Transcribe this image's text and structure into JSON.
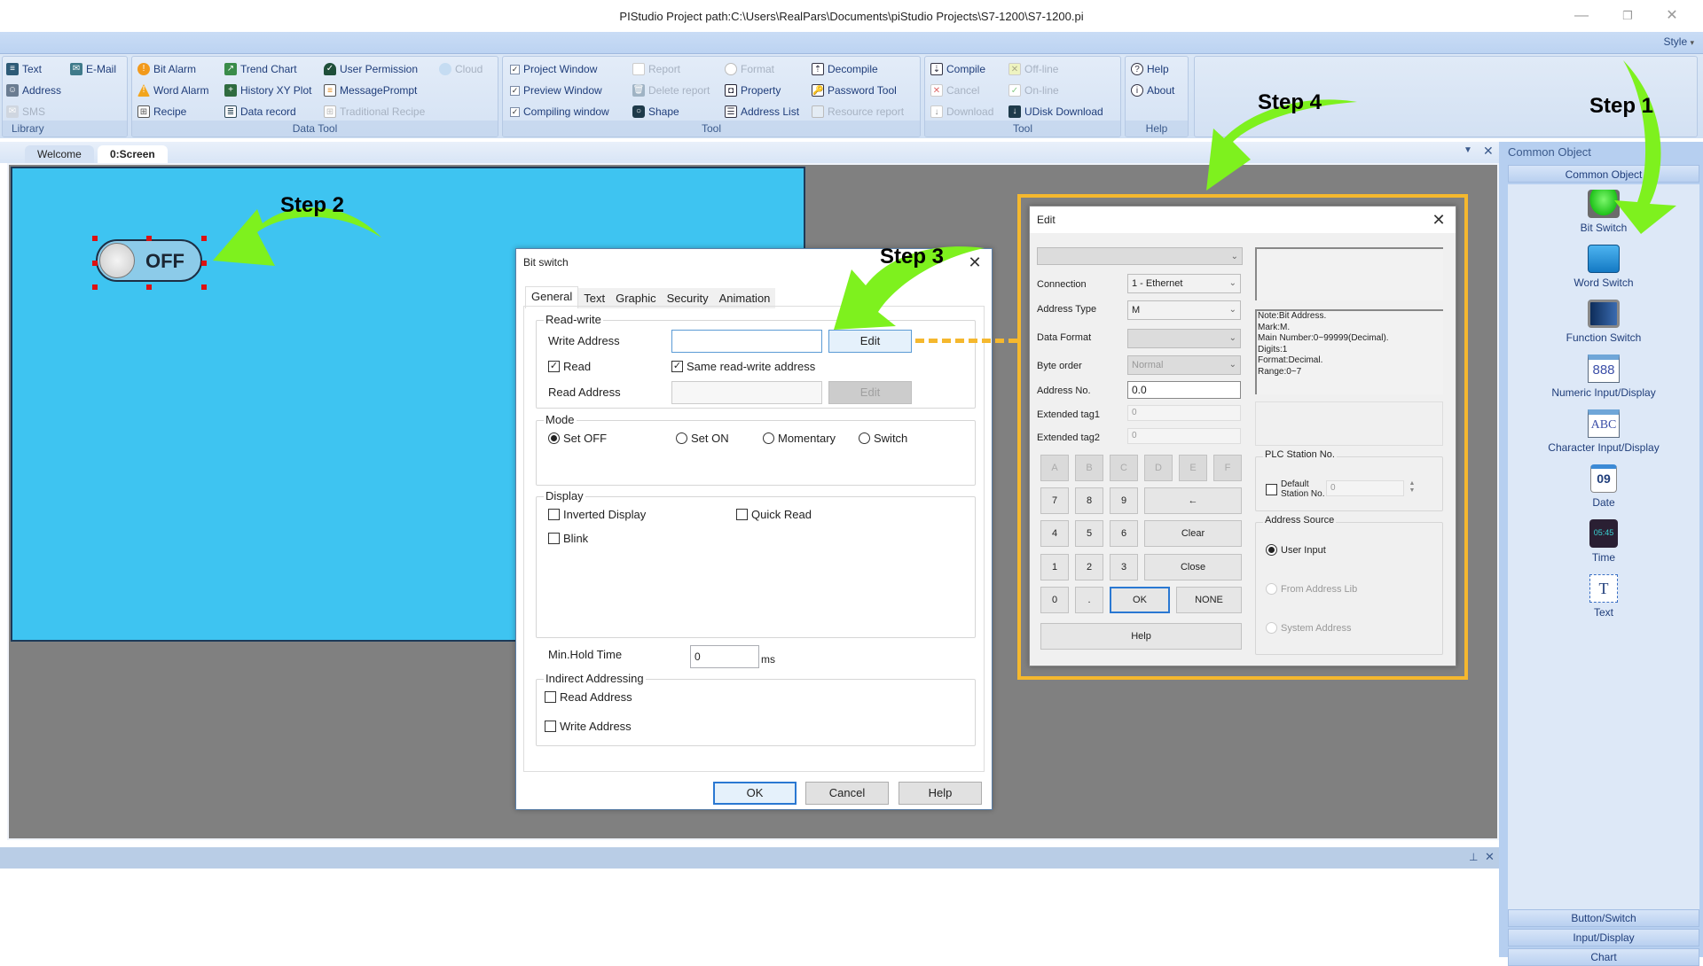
{
  "window": {
    "title": "PIStudio   Project path:C:\\Users\\RealPars\\Documents\\piStudio Projects\\S7-1200\\S7-1200.pi",
    "minimize": "—",
    "restore": "❐",
    "close": "✕",
    "style_menu": "Style"
  },
  "ribbon": {
    "library": {
      "label": "Library",
      "items": [
        {
          "label": "Text",
          "icon": "text-icon",
          "enabled": true
        },
        {
          "label": "E-Mail",
          "icon": "email-icon",
          "enabled": true
        },
        {
          "label": "Address",
          "icon": "address-icon",
          "enabled": true
        },
        {
          "label": "SMS",
          "icon": "sms-icon",
          "enabled": false
        }
      ]
    },
    "data_tool": {
      "label": "Data Tool",
      "items": [
        {
          "label": "Bit Alarm",
          "icon": "bit-alarm-icon",
          "enabled": true
        },
        {
          "label": "Word Alarm",
          "icon": "word-alarm-icon",
          "enabled": true
        },
        {
          "label": "Recipe",
          "icon": "recipe-icon",
          "enabled": true
        },
        {
          "label": "Trend Chart",
          "icon": "trend-chart-icon",
          "enabled": true
        },
        {
          "label": "History XY Plot",
          "icon": "history-xy-plot-icon",
          "enabled": true
        },
        {
          "label": "Data record",
          "icon": "data-record-icon",
          "enabled": true
        },
        {
          "label": "User Permission",
          "icon": "user-permission-icon",
          "enabled": true
        },
        {
          "label": "MessagePrompt",
          "icon": "message-prompt-icon",
          "enabled": true
        },
        {
          "label": "Traditional Recipe",
          "icon": "traditional-recipe-icon",
          "enabled": false
        },
        {
          "label": "Cloud",
          "icon": "cloud-icon",
          "enabled": false
        }
      ]
    },
    "tool1": {
      "label": "Tool",
      "items": [
        {
          "label": "Project Window",
          "checked": true
        },
        {
          "label": "Preview Window",
          "checked": true
        },
        {
          "label": "Compiling window",
          "checked": true
        },
        {
          "label": "Report",
          "icon": "report-icon",
          "enabled": false
        },
        {
          "label": "Delete report",
          "icon": "delete-report-icon",
          "enabled": false
        },
        {
          "label": "Shape",
          "icon": "shape-icon",
          "enabled": true
        },
        {
          "label": "Format",
          "icon": "format-icon",
          "enabled": false
        },
        {
          "label": "Property",
          "icon": "property-icon",
          "enabled": true
        },
        {
          "label": "Address List",
          "icon": "address-list-icon",
          "enabled": true
        },
        {
          "label": "Decompile",
          "icon": "decompile-icon",
          "enabled": true
        },
        {
          "label": "Password Tool",
          "icon": "password-tool-icon",
          "enabled": true
        },
        {
          "label": "Resource report",
          "icon": "resource-report-icon",
          "enabled": false
        }
      ]
    },
    "tool2": {
      "label": "Tool",
      "items": [
        {
          "label": "Compile",
          "icon": "compile-icon",
          "enabled": true
        },
        {
          "label": "Cancel",
          "icon": "cancel-icon",
          "enabled": false
        },
        {
          "label": "Download",
          "icon": "download-icon",
          "enabled": false
        },
        {
          "label": "Off-line",
          "icon": "offline-icon",
          "enabled": false
        },
        {
          "label": "On-line",
          "icon": "online-icon",
          "enabled": false
        },
        {
          "label": "UDisk Download",
          "icon": "udisk-download-icon",
          "enabled": true
        }
      ]
    },
    "help": {
      "label": "Help",
      "items": [
        {
          "label": "Help",
          "icon": "help-icon"
        },
        {
          "label": "About",
          "icon": "about-icon"
        }
      ]
    }
  },
  "doc_tabs": [
    {
      "label": "Welcome",
      "active": false
    },
    {
      "label": "0:Screen",
      "active": true
    }
  ],
  "canvas": {
    "background": "#3ec4f1",
    "toggle_label": "OFF"
  },
  "annotations": {
    "step1": "Step 1",
    "step2": "Step 2",
    "step3": "Step 3",
    "step4": "Step 4",
    "arrow_color": "#7ef11e",
    "highlight_color": "#f5b82e"
  },
  "right_panel": {
    "header": "Common Object",
    "section": "Common Object",
    "tools": [
      {
        "label": "Bit Switch",
        "icon": "bit-switch-icon"
      },
      {
        "label": "Word Switch",
        "icon": "word-switch-icon"
      },
      {
        "label": "Function Switch",
        "icon": "function-switch-icon"
      },
      {
        "label": "Numeric Input/Display",
        "icon": "numeric-input-icon",
        "glyph": "888"
      },
      {
        "label": "Character Input/Display",
        "icon": "character-input-icon",
        "glyph": "ABC"
      },
      {
        "label": "Date",
        "icon": "date-icon",
        "glyph": "09"
      },
      {
        "label": "Time",
        "icon": "time-icon",
        "glyph": "05:45"
      },
      {
        "label": "Text",
        "icon": "text-tool-icon",
        "glyph": "T"
      }
    ],
    "bottom_sections": [
      "Button/Switch",
      "Input/Display",
      "Chart"
    ]
  },
  "bit_switch_dialog": {
    "title": "Bit switch",
    "tabs": [
      "General",
      "Text",
      "Graphic",
      "Security",
      "Animation"
    ],
    "active_tab": "General",
    "read_write": {
      "legend": "Read-write",
      "write_address_label": "Write Address",
      "write_address_value": "",
      "edit_label": "Edit",
      "read_label": "Read",
      "read_checked": true,
      "same_label": "Same read-write address",
      "same_checked": true,
      "read_address_label": "Read Address",
      "read_address_value": "",
      "read_edit_label": "Edit"
    },
    "mode": {
      "legend": "Mode",
      "options": [
        "Set OFF",
        "Set ON",
        "Momentary",
        "Switch"
      ],
      "selected": "Set OFF"
    },
    "display": {
      "legend": "Display",
      "inverted": "Inverted Display",
      "quick_read": "Quick Read",
      "blink": "Blink"
    },
    "min_hold_label": "Min.Hold Time",
    "min_hold_value": "0",
    "min_hold_unit": "ms",
    "indirect": {
      "legend": "Indirect Addressing",
      "read": "Read Address",
      "write": "Write Address"
    },
    "ok": "OK",
    "cancel": "Cancel",
    "help": "Help"
  },
  "edit_dialog": {
    "title": "Edit",
    "top_select": "",
    "connection_label": "Connection",
    "connection_value": "1 - Ethernet",
    "address_type_label": "Address Type",
    "address_type_value": "M",
    "data_format_label": "Data Format",
    "data_format_value": "",
    "byte_order_label": "Byte order",
    "byte_order_value": "Normal",
    "address_no_label": "Address No.",
    "address_no_value": "0.0",
    "ext1_label": "Extended tag1",
    "ext1_value": "0",
    "ext2_label": "Extended tag2",
    "ext2_value": "0",
    "hex_keys": [
      "A",
      "B",
      "C",
      "D",
      "E",
      "F"
    ],
    "keys_row1": [
      "7",
      "8",
      "9"
    ],
    "keys_row2": [
      "4",
      "5",
      "6"
    ],
    "keys_row3": [
      "1",
      "2",
      "3"
    ],
    "keys_row4": [
      "0",
      "."
    ],
    "backspace": "←",
    "clear": "Clear",
    "close": "Close",
    "ok": "OK",
    "none": "NONE",
    "help": "Help",
    "note_lines": [
      "Note:Bit Address.",
      "Mark:M.",
      "Main Number:0~99999(Decimal).",
      "Digits:1",
      "Format:Decimal.",
      "Range:0~7"
    ],
    "plc_station_legend": "PLC Station No.",
    "default_station_label": "Default Station No.",
    "station_value": "0",
    "address_source_legend": "Address Source",
    "address_source_options": [
      {
        "label": "User Input",
        "selected": true,
        "enabled": true
      },
      {
        "label": "From Address Lib",
        "selected": false,
        "enabled": false
      },
      {
        "label": "System Address",
        "selected": false,
        "enabled": false
      }
    ]
  }
}
